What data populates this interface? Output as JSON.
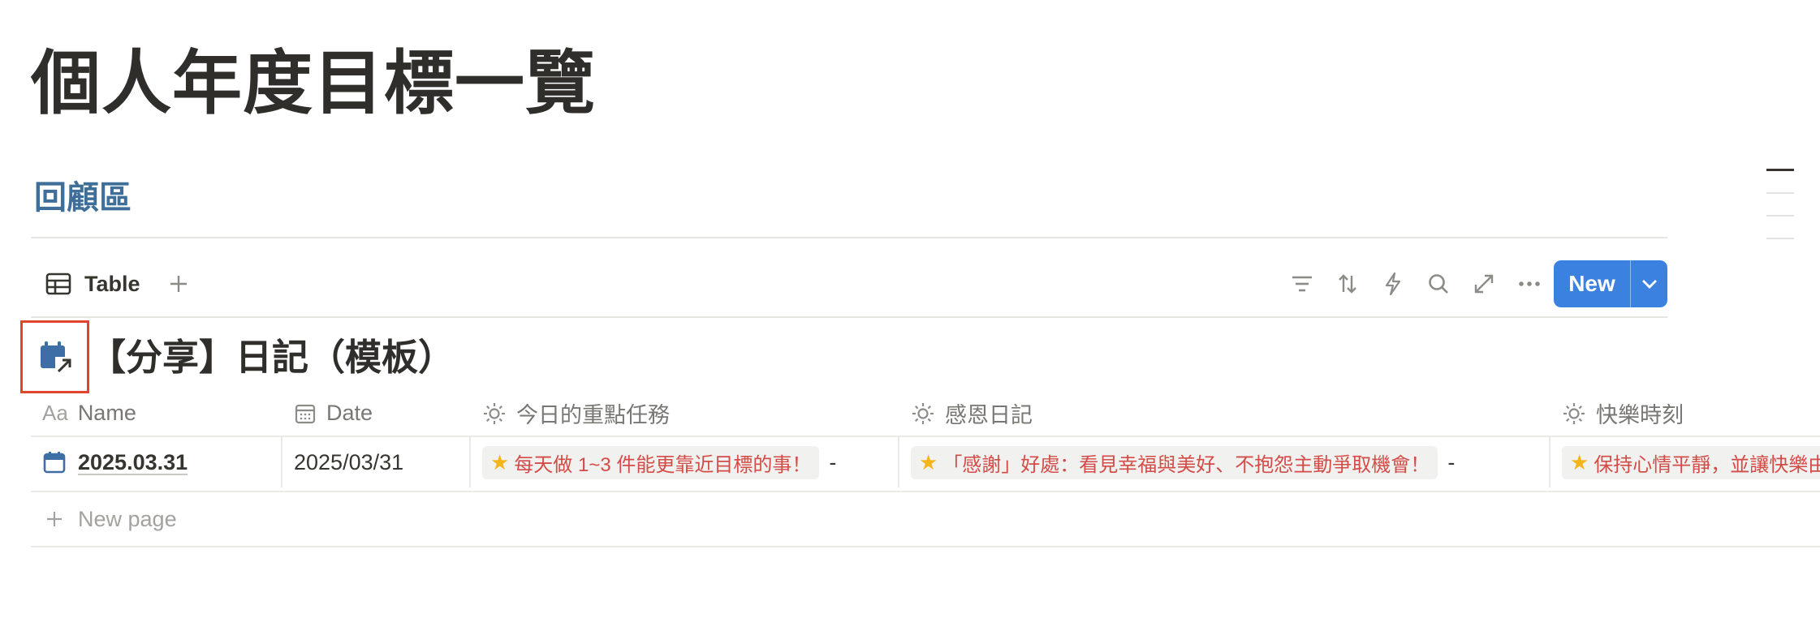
{
  "page": {
    "title": "個人年度目標一覽",
    "section_heading": "回顧區"
  },
  "toolbar": {
    "view_tab_label": "Table",
    "tools": [
      "filter-icon",
      "sort-icon",
      "automation-icon",
      "search-icon",
      "expand-icon",
      "more-icon"
    ],
    "new_button_label": "New"
  },
  "database": {
    "icon": "calendar-link-icon",
    "title": "【分享】日記（模板）"
  },
  "table": {
    "columns": [
      {
        "label": "Name",
        "icon": "Aa"
      },
      {
        "label": "Date",
        "icon": "calendar-icon"
      },
      {
        "label": "今日的重點任務",
        "icon": "sun-icon"
      },
      {
        "label": "感恩日記",
        "icon": "sun-icon"
      },
      {
        "label": "快樂時刻",
        "icon": "sun-icon"
      }
    ],
    "rows": [
      {
        "name": "2025.03.31",
        "date": "2025/03/31",
        "task": "每天做  1~3  件能更靠近目標的事！",
        "thanks": "「感謝」好處：看見幸福與美好、不抱怨主動爭取機會！",
        "happy": "保持心情平靜，並讓快樂由",
        "dash": "-"
      }
    ],
    "new_page_label": "New page"
  },
  "colors": {
    "accent": "#3b82e0",
    "heading_blue": "#3f6f98",
    "tag_text": "#d44c47",
    "highlight_box": "#e0452b"
  }
}
